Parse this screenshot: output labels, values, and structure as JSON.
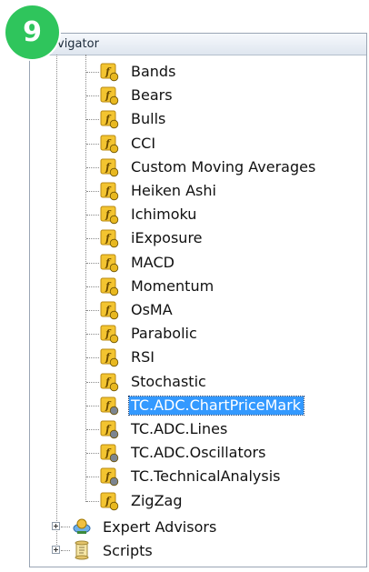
{
  "badge": "9",
  "window": {
    "title_visible": "vigator"
  },
  "indicators": [
    {
      "label": "Bands",
      "kind": "standard"
    },
    {
      "label": "Bears",
      "kind": "standard"
    },
    {
      "label": "Bulls",
      "kind": "standard"
    },
    {
      "label": "CCI",
      "kind": "standard"
    },
    {
      "label": "Custom Moving Averages",
      "kind": "standard"
    },
    {
      "label": "Heiken Ashi",
      "kind": "standard"
    },
    {
      "label": "Ichimoku",
      "kind": "standard"
    },
    {
      "label": "iExposure",
      "kind": "standard"
    },
    {
      "label": "MACD",
      "kind": "standard"
    },
    {
      "label": "Momentum",
      "kind": "standard"
    },
    {
      "label": "OsMA",
      "kind": "standard"
    },
    {
      "label": "Parabolic",
      "kind": "standard"
    },
    {
      "label": "RSI",
      "kind": "standard"
    },
    {
      "label": "Stochastic",
      "kind": "standard"
    },
    {
      "label": "TC.ADC.ChartPriceMark",
      "kind": "custom",
      "selected": true
    },
    {
      "label": "TC.ADC.Lines",
      "kind": "custom"
    },
    {
      "label": "TC.ADC.Oscillators",
      "kind": "custom"
    },
    {
      "label": "TC.TechnicalAnalysis",
      "kind": "custom"
    },
    {
      "label": "ZigZag",
      "kind": "standard"
    }
  ],
  "top_nodes": [
    {
      "label": "Expert Advisors",
      "icon": "expert-advisor-icon"
    },
    {
      "label": "Scripts",
      "icon": "script-scroll-icon"
    }
  ],
  "colors": {
    "selection": "#3399ff",
    "badge": "#2fc55c",
    "indicator_icon": "#f3c430"
  }
}
